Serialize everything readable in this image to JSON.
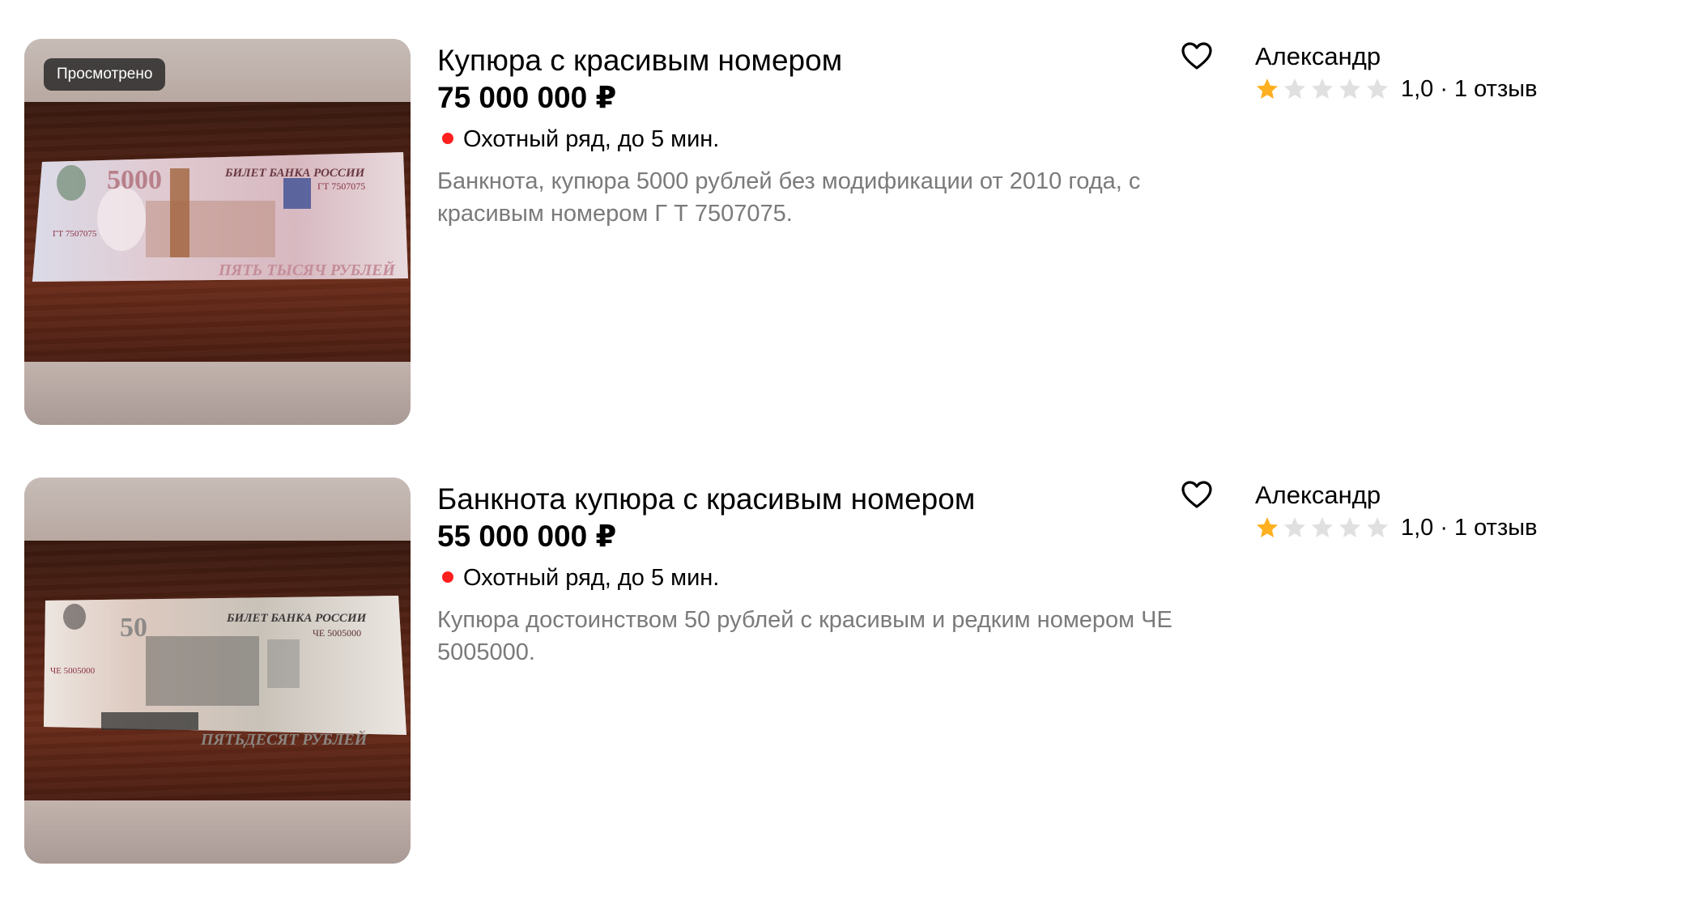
{
  "listings": [
    {
      "badge": "Просмотрено",
      "title": "Купюра с красивым номером",
      "price": "75 000 000 ₽",
      "location": "Охотный ряд, до 5 мин.",
      "description": "Банкнота, купюра 5000 рублей без модификации от 2010 года, с красивым номером Г Т 7507075.",
      "seller": {
        "name": "Александр",
        "rating": 1,
        "score": "1,0",
        "separator": "·",
        "reviews": "1 отзыв"
      },
      "photo": {
        "denomination": "5000",
        "bank_text": "БИЛЕТ БАНКА РОССИИ",
        "serial": "ГТ 7507075",
        "amount_words": "ПЯТЬ ТЫСЯЧ РУБЛЕЙ",
        "note_color": "#e9dede",
        "accent_color": "#b7808a"
      }
    },
    {
      "badge": "",
      "title": "Банкнота купюра с красивым номером",
      "price": "55 000 000 ₽",
      "location": "Охотный ряд, до 5 мин.",
      "description": "Купюра достоинством 50 рублей с красивым и редким номером ЧЕ 5005000.",
      "seller": {
        "name": "Александр",
        "rating": 1,
        "score": "1,0",
        "separator": "·",
        "reviews": "1 отзыв"
      },
      "photo": {
        "denomination": "50",
        "bank_text": "БИЛЕТ БАНКА РОССИИ",
        "serial": "ЧЕ 5005000",
        "amount_words": "ПЯТЬДЕСЯТ РУБЛЕЙ",
        "note_color": "#ece6e1",
        "accent_color": "#8d8a88"
      }
    }
  ],
  "colors": {
    "location_dot": "#ff1f1f",
    "star_filled": "#ffb021",
    "star_empty": "#e0e0e0",
    "description_text": "#7a7a7a"
  },
  "icons": {
    "favorite": "heart-outline-icon",
    "star": "star-icon"
  }
}
